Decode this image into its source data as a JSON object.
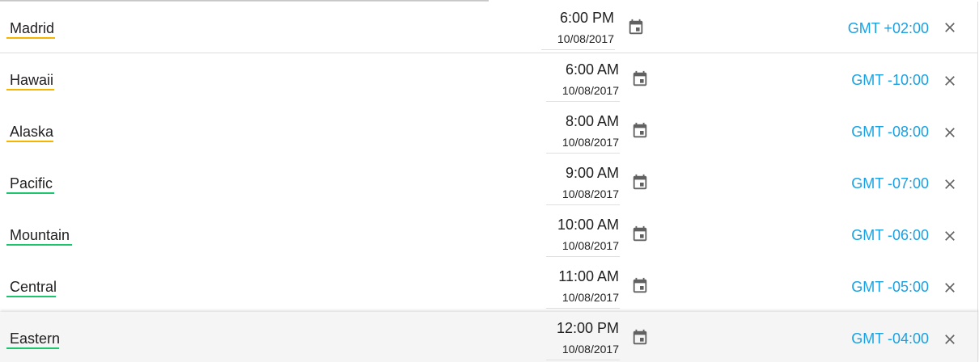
{
  "rows": [
    {
      "city": "Madrid",
      "time": "6:00 PM",
      "date": "10/08/2017",
      "offset": "GMT +02:00",
      "city_accent": "#f5b400"
    },
    {
      "city": "Hawaii",
      "time": "6:00 AM",
      "date": "10/08/2017",
      "offset": "GMT -10:00",
      "city_accent": "#f5b400"
    },
    {
      "city": "Alaska",
      "time": "8:00 AM",
      "date": "10/08/2017",
      "offset": "GMT -08:00",
      "city_accent": "#f5b400"
    },
    {
      "city": "Pacific",
      "time": "9:00 AM",
      "date": "10/08/2017",
      "offset": "GMT -07:00",
      "city_accent": "#1ec36e"
    },
    {
      "city": "Mountain",
      "time": "10:00 AM",
      "date": "10/08/2017",
      "offset": "GMT -06:00",
      "city_accent": "#1ec36e"
    },
    {
      "city": "Central",
      "time": "11:00 AM",
      "date": "10/08/2017",
      "offset": "GMT -05:00",
      "city_accent": "#1ec36e"
    },
    {
      "city": "Eastern",
      "time": "12:00 PM",
      "date": "10/08/2017",
      "offset": "GMT -04:00",
      "city_accent": "#1ec36e"
    }
  ],
  "icons": {
    "calendar": "calendar-icon",
    "close": "close-icon"
  },
  "colors": {
    "offset_link": "#1ba1e2",
    "icon": "#616161",
    "divider": "#dedede"
  }
}
